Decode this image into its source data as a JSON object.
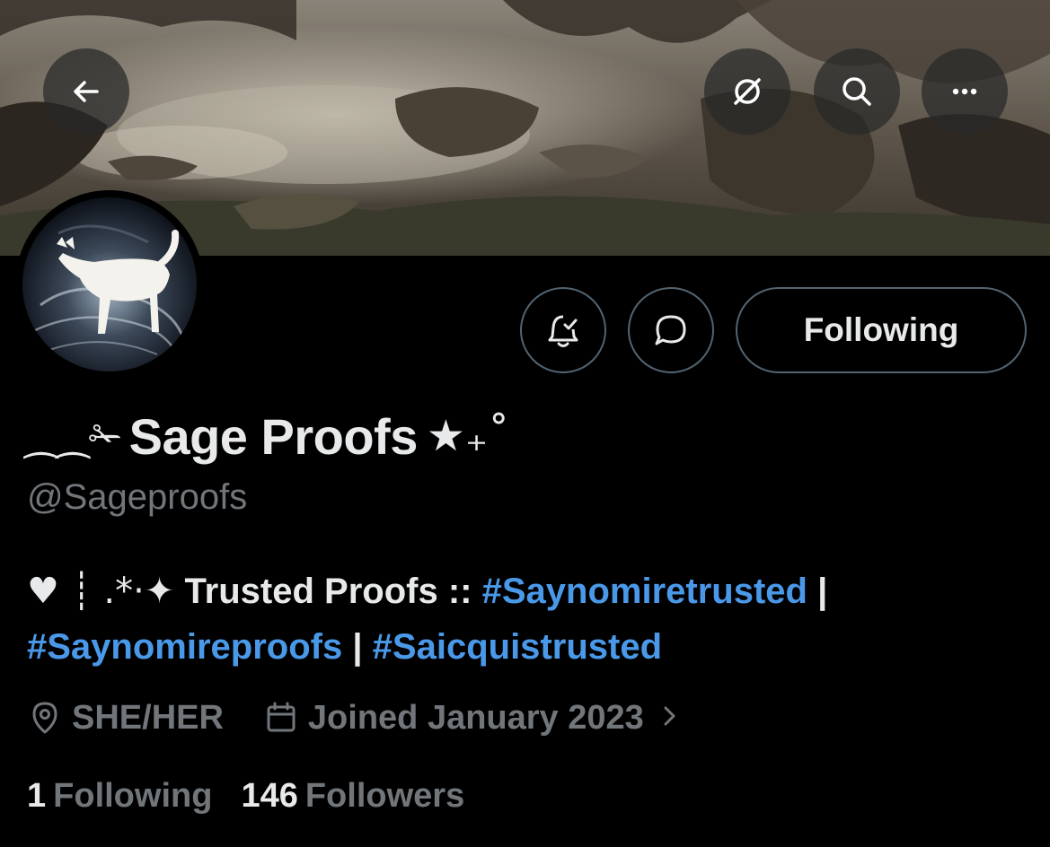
{
  "header": {
    "back_icon": "arrow-left-icon",
    "translate_icon": "translate-off-icon",
    "search_icon": "search-icon",
    "more_icon": "more-horizontal-icon"
  },
  "profile": {
    "name_prefix": "⁔⁔✁",
    "name": "Sage Proofs",
    "name_suffix": "★₊˚",
    "handle": "@Sageproofs",
    "avatar_icon": "avatar-white-cat"
  },
  "actions": {
    "notify_icon": "bell-check-icon",
    "message_icon": "chat-bubble-icon",
    "following_label": "Following"
  },
  "bio": {
    "deco": "♥ ┊ .*·✦",
    "text": "Trusted Proofs ::",
    "tag1": "#Saynomiretrusted",
    "sep1": "|",
    "tag2": "#Saynomireproofs",
    "sep2": "|",
    "tag3": "#Saicquistrusted"
  },
  "meta": {
    "location_icon": "location-pin-icon",
    "location": "SHE/HER",
    "calendar_icon": "calendar-icon",
    "joined": "Joined January 2023",
    "chevron_icon": "chevron-right-icon"
  },
  "stats": {
    "following_count": "1",
    "following_label": "Following",
    "followers_count": "146",
    "followers_label": "Followers"
  },
  "colors": {
    "background": "#000000",
    "text_primary": "#e7e9ea",
    "text_secondary": "#71767b",
    "link": "#4a99e9",
    "border": "#536471"
  }
}
